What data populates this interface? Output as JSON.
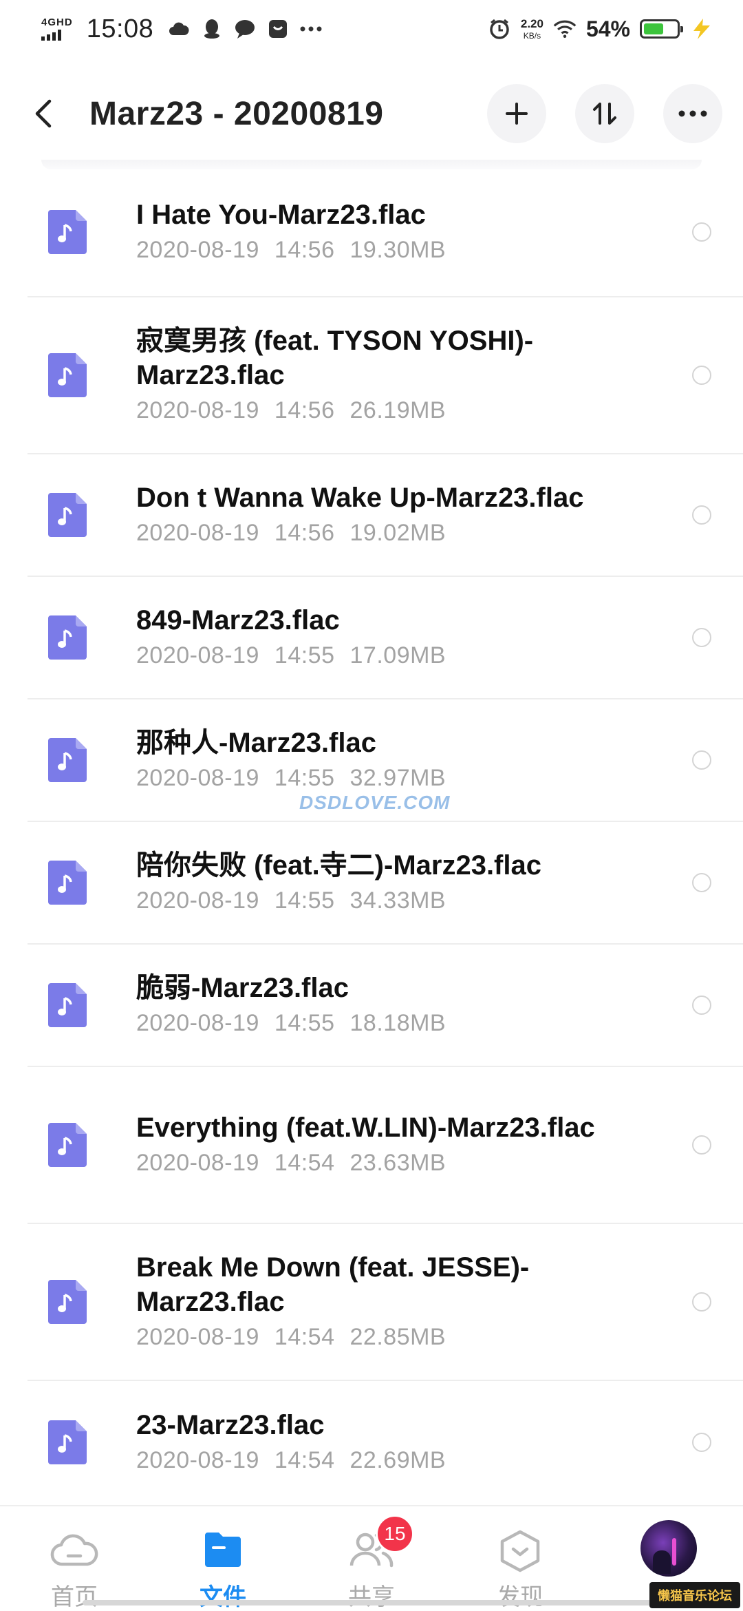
{
  "status_bar": {
    "network": "4GHD",
    "time": "15:08",
    "speed_value": "2.20",
    "speed_unit": "KB/s",
    "battery_percent": "54%",
    "battery_level": 0.54
  },
  "header": {
    "title": "Marz23 - 20200819"
  },
  "files": [
    {
      "name": "I Hate You-Marz23.flac",
      "date": "2020-08-19",
      "time": "14:56",
      "size": "19.30MB"
    },
    {
      "name": "寂寞男孩 (feat. TYSON YOSHI)-Marz23.flac",
      "date": "2020-08-19",
      "time": "14:56",
      "size": "26.19MB"
    },
    {
      "name": "Don t Wanna Wake Up-Marz23.flac",
      "date": "2020-08-19",
      "time": "14:56",
      "size": "19.02MB"
    },
    {
      "name": "849-Marz23.flac",
      "date": "2020-08-19",
      "time": "14:55",
      "size": "17.09MB"
    },
    {
      "name": "那种人-Marz23.flac",
      "date": "2020-08-19",
      "time": "14:55",
      "size": "32.97MB"
    },
    {
      "name": "陪你失败 (feat.寺二)-Marz23.flac",
      "date": "2020-08-19",
      "time": "14:55",
      "size": "34.33MB"
    },
    {
      "name": "脆弱-Marz23.flac",
      "date": "2020-08-19",
      "time": "14:55",
      "size": "18.18MB"
    },
    {
      "name": "Everything (feat.W.LIN)-Marz23.flac",
      "date": "2020-08-19",
      "time": "14:54",
      "size": "23.63MB"
    },
    {
      "name": "Break Me Down (feat. JESSE)-Marz23.flac",
      "date": "2020-08-19",
      "time": "14:54",
      "size": "22.85MB"
    },
    {
      "name": "23-Marz23.flac",
      "date": "2020-08-19",
      "time": "14:54",
      "size": "22.69MB"
    }
  ],
  "watermark": "DSDLOVE.COM",
  "corner_watermark": "懒猫音乐论坛",
  "bottom_nav": {
    "home": "首页",
    "files": "文件",
    "share": "共享",
    "share_badge": "15",
    "discover": "发现"
  },
  "colors": {
    "accent": "#1c8cf2",
    "file_icon": "#7b7be8",
    "badge": "#f2344a"
  }
}
